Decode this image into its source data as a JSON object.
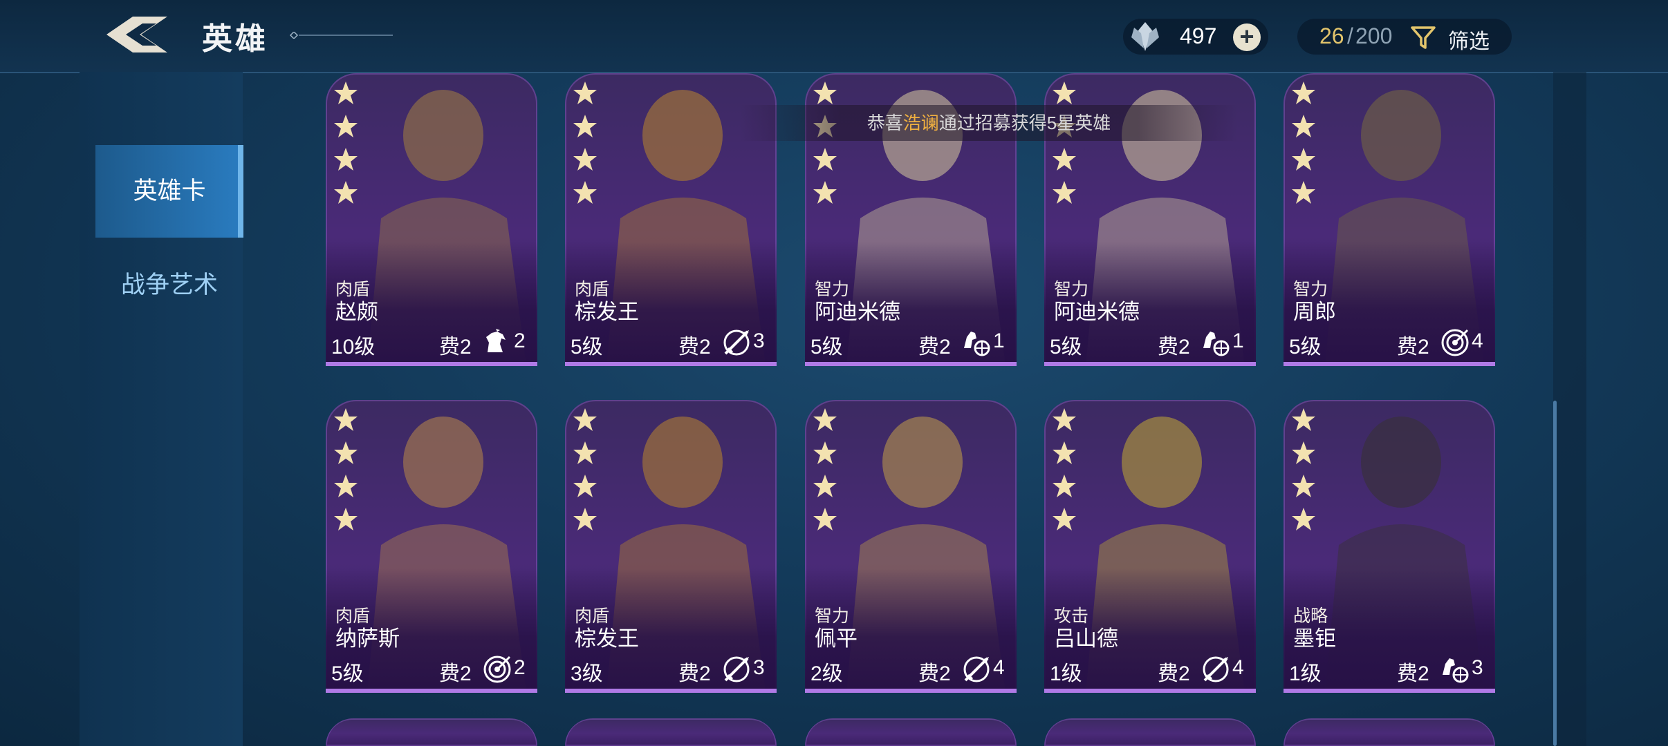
{
  "header": {
    "title": "英雄",
    "currency_icon": "crystal-icon",
    "currency_value": "497",
    "capacity_current": "26",
    "capacity_separator": "/",
    "capacity_max": "200",
    "filter_label": "筛选"
  },
  "sidebar": {
    "tabs": [
      {
        "label": "英雄卡",
        "active": true
      },
      {
        "label": "战争艺术",
        "active": false
      }
    ]
  },
  "notice": {
    "prefix": "恭喜",
    "player": "浩谰",
    "suffix": "通过招募获得5星英雄"
  },
  "colors": {
    "card_purple": "#4a2a78",
    "active_tab": "#2a7cc0",
    "gold": "#e3c56c",
    "notice_highlight": "#f0b040"
  },
  "heroes": [
    {
      "role": "肉盾",
      "name": "赵颇",
      "level": "10级",
      "cost": "费2",
      "skill_icon": "horse-head-icon",
      "skill_num": "2",
      "stars": 4
    },
    {
      "role": "肉盾",
      "name": "棕发王",
      "level": "5级",
      "cost": "费2",
      "skill_icon": "crossed-weapon-icon",
      "skill_num": "3",
      "stars": 4
    },
    {
      "role": "智力",
      "name": "阿迪米德",
      "level": "5级",
      "cost": "费2",
      "skill_icon": "chariot-icon",
      "skill_num": "1",
      "stars": 4
    },
    {
      "role": "智力",
      "name": "阿迪米德",
      "level": "5级",
      "cost": "费2",
      "skill_icon": "chariot-icon",
      "skill_num": "1",
      "stars": 4
    },
    {
      "role": "智力",
      "name": "周郎",
      "level": "5级",
      "cost": "费2",
      "skill_icon": "target-icon",
      "skill_num": "4",
      "stars": 4
    },
    {
      "role": "肉盾",
      "name": "纳萨斯",
      "level": "5级",
      "cost": "费2",
      "skill_icon": "target-icon",
      "skill_num": "2",
      "stars": 4
    },
    {
      "role": "肉盾",
      "name": "棕发王",
      "level": "3级",
      "cost": "费2",
      "skill_icon": "crossed-weapon-icon",
      "skill_num": "3",
      "stars": 4
    },
    {
      "role": "智力",
      "name": "佩平",
      "level": "2级",
      "cost": "费2",
      "skill_icon": "crossed-weapon-icon",
      "skill_num": "4",
      "stars": 4
    },
    {
      "role": "攻击",
      "name": "吕山德",
      "level": "1级",
      "cost": "费2",
      "skill_icon": "crossed-weapon-icon",
      "skill_num": "4",
      "stars": 4
    },
    {
      "role": "战略",
      "name": "墨钜",
      "level": "1级",
      "cost": "费2",
      "skill_icon": "chariot-icon",
      "skill_num": "3",
      "stars": 4
    }
  ]
}
